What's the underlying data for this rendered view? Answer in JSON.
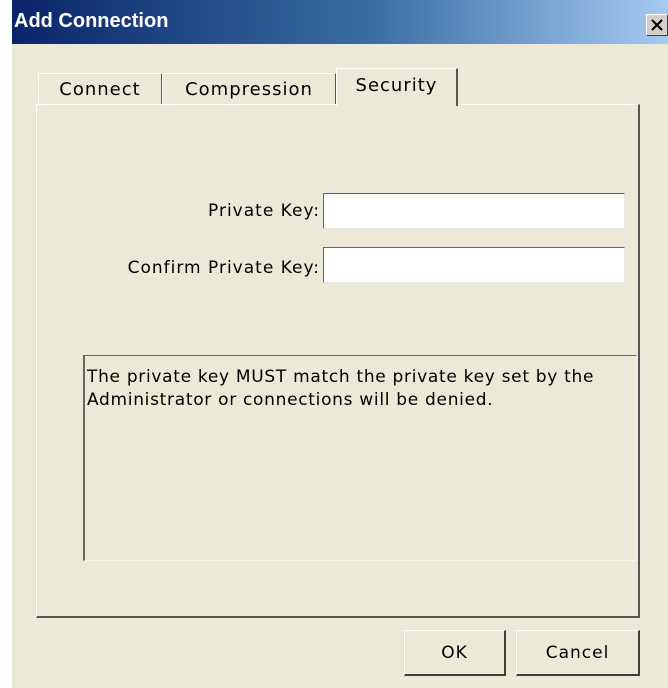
{
  "window": {
    "title": "Add Connection",
    "close_icon": "close-icon"
  },
  "tabs": [
    {
      "label": "Connect",
      "active": false
    },
    {
      "label": "Compression",
      "active": false
    },
    {
      "label": "Security",
      "active": true
    }
  ],
  "form": {
    "private_key_label": "Private Key:",
    "private_key_value": "",
    "confirm_key_label": "Confirm Private Key:",
    "confirm_key_value": ""
  },
  "note": {
    "text": "The private key MUST match the private key set by the Administrator or connections will be denied."
  },
  "buttons": {
    "ok_label": "OK",
    "cancel_label": "Cancel"
  },
  "colors": {
    "titlebar_start": "#0a246a",
    "titlebar_end": "#a6caf0",
    "dialog_background": "#ece9d8"
  }
}
